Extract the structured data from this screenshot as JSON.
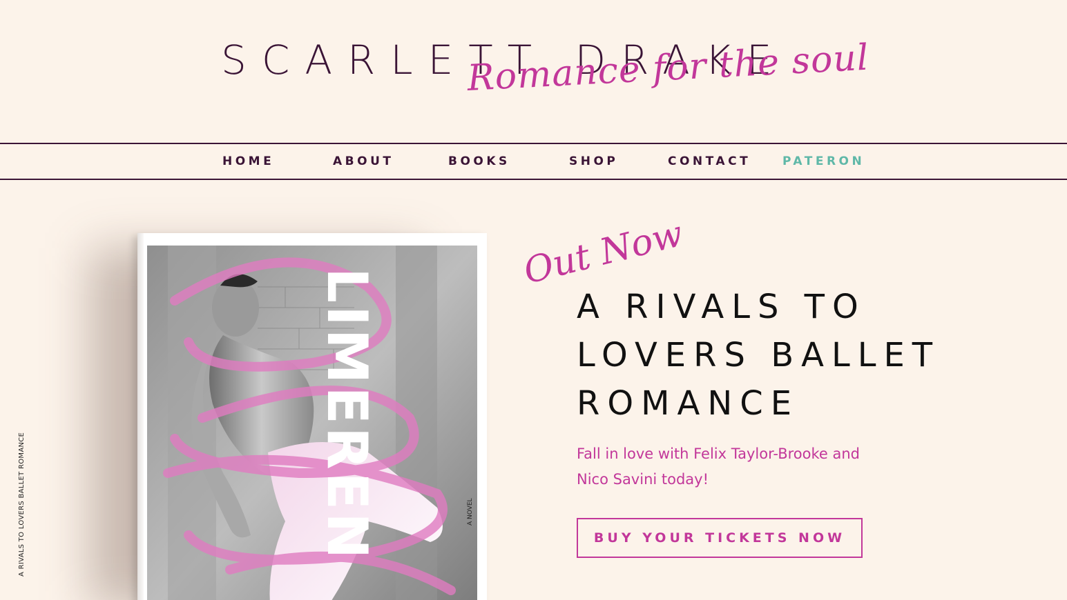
{
  "brand": {
    "name": "SCARLETT DRAKE",
    "tagline": "Romance for the soul"
  },
  "nav": {
    "items": [
      {
        "label": "HOME"
      },
      {
        "label": "ABOUT"
      },
      {
        "label": "BOOKS"
      },
      {
        "label": "SHOP"
      },
      {
        "label": "CONTACT"
      },
      {
        "label": "PATERON"
      }
    ]
  },
  "book": {
    "title": "LIMEREN",
    "side_text": "A RIVALS TO LOVERS BALLET ROMANCE",
    "novel_text": "A NOVEL"
  },
  "hero": {
    "eyebrow": "Out Now",
    "heading": "A RIVALS TO LOVERS BALLET ROMANCE",
    "subtext": "Fall in love with Felix Taylor-Brooke and Nico Savini today!",
    "cta_label": "BUY YOUR TICKETS NOW"
  },
  "colors": {
    "background": "#fcf3ea",
    "plum": "#3a1436",
    "pink": "#c2379a",
    "teal": "#5fb8a8"
  }
}
